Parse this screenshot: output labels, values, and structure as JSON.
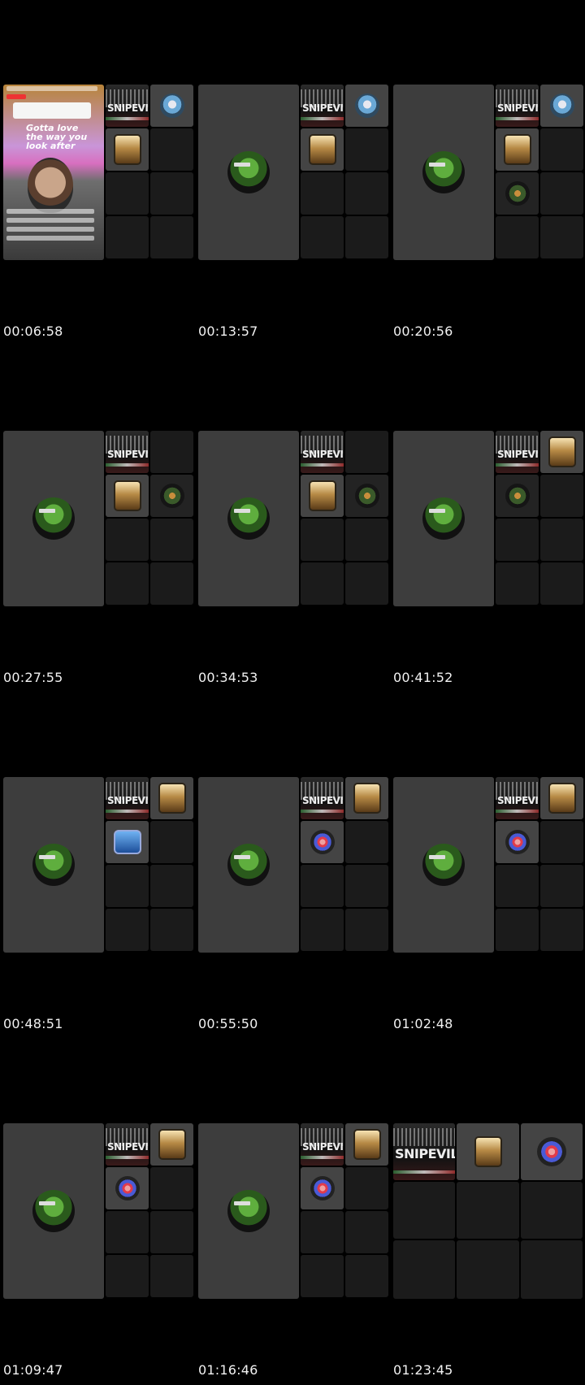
{
  "timestamps": [
    "00:06:58",
    "00:13:57",
    "00:20:56",
    "00:27:55",
    "00:34:53",
    "00:41:52",
    "00:48:51",
    "00:55:50",
    "01:02:48",
    "01:09:47",
    "01:16:46",
    "01:23:45"
  ],
  "frame1_text": {
    "note_line1": "1. Your dad not letting you go",
    "note_line2": "to school isn't dhulm",
    "note_line3": "(if you're a bint)",
    "big_text": "Gotta love the way you look after",
    "brand_text": "SNIPEVILLE"
  },
  "tile_icons": [
    "brand-logo-icon",
    "coffee-mug-icon",
    "frog-avatar-icon",
    "face-avatar-icon",
    "portrait-avatar-icon",
    "robot-avatar-icon",
    "cartoon-avatar-icon"
  ]
}
